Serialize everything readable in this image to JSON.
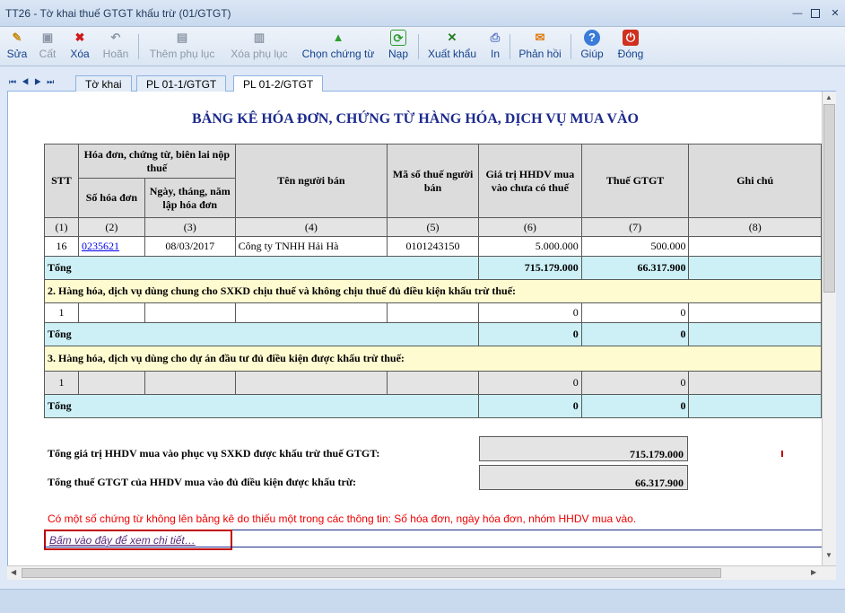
{
  "window": {
    "title": "TT26 - Tờ khai thuế GTGT khấu trừ (01/GTGT)"
  },
  "toolbar": {
    "sua": "Sửa",
    "cat": "Cất",
    "xoa": "Xóa",
    "hoan": "Hoãn",
    "them_phu_luc": "Thêm phụ lục",
    "xoa_phu_luc": "Xóa phụ lục",
    "chon_chung_tu": "Chọn chứng từ",
    "nap": "Nạp",
    "xuat_khau": "Xuất khẩu",
    "in": "In",
    "phan_hoi": "Phản hồi",
    "giup": "Giúp",
    "dong": "Đóng"
  },
  "tabs": [
    "Tờ khai",
    "PL 01-1/GTGT",
    "PL 01-2/GTGT"
  ],
  "form": {
    "heading": "BẢNG KÊ HÓA ĐƠN, CHỨNG TỪ HÀNG HÓA, DỊCH VỤ MUA VÀO",
    "headers": {
      "stt": "STT",
      "invoice_group": "Hóa đơn, chứng từ, biên lai nộp thuế",
      "so_hoa_don": "Số hóa đơn",
      "ngay": "Ngày, tháng, năm lập hóa đơn",
      "ten_nguoi_ban": "Tên người bán",
      "ma_so_thue": "Mã số thuế người bán",
      "gia_tri": "Giá trị HHDV mua vào chưa có thuế",
      "thue": "Thuế GTGT",
      "ghi_chu": "Ghi chú"
    },
    "col_numbers": [
      "(1)",
      "(2)",
      "(3)",
      "(4)",
      "(5)",
      "(6)",
      "(7)",
      "(8)"
    ],
    "row1": {
      "stt": "16",
      "so_hoa_don": "0235621",
      "ngay": "08/03/2017",
      "ten": "Công ty TNHH Hải Hà",
      "mst": "0101243150",
      "gia_tri": "5.000.000",
      "thue": "500.000"
    },
    "total_label": "Tổng",
    "total1": {
      "gia_tri": "715.179.000",
      "thue": "66.317.900"
    },
    "section2": "2. Hàng hóa, dịch vụ dùng chung cho SXKD chịu thuế và không chịu thuế đủ điều kiện khấu trừ thuế:",
    "row2": {
      "stt": "1",
      "gia_tri": "0",
      "thue": "0"
    },
    "total2": {
      "gia_tri": "0",
      "thue": "0"
    },
    "section3": "3. Hàng hóa, dịch vụ dùng cho dự án đầu tư đủ điều kiện được khấu trừ thuế:",
    "row3": {
      "stt": "1",
      "gia_tri": "0",
      "thue": "0"
    },
    "total3": {
      "gia_tri": "0",
      "thue": "0"
    },
    "summary": {
      "label1": "Tổng giá trị HHDV mua vào phục vụ SXKD được khấu trừ thuế GTGT:",
      "value1": "715.179.000",
      "label2": "Tổng thuế GTGT của HHDV mua vào đủ điều kiện được khấu trừ:",
      "value2": "66.317.900"
    },
    "note": "Có một số chứng từ không lên bảng kê do thiếu một trong các thông tin: Số hóa đơn, ngày hóa đơn, nhóm HHDV mua vào.",
    "detail_link": "Bấm vào đây để xem chi tiết…"
  }
}
